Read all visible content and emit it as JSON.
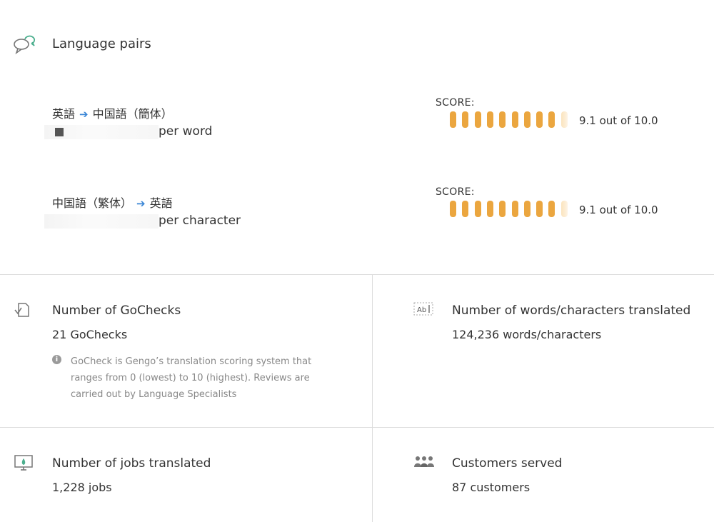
{
  "header": {
    "title": "Language pairs",
    "icon": "speech-bubbles-icon"
  },
  "pairs": [
    {
      "source": "英語",
      "target": "中国語（簡体）",
      "arrow": "➔",
      "price_unit": "per word",
      "score_label": "SCORE:",
      "score": 9.1,
      "score_text": "9.1 out of 10.0"
    },
    {
      "source": "中国語（繁体）",
      "target": "英語",
      "arrow": "➔",
      "price_unit": "per character",
      "score_label": "SCORE:",
      "score": 9.1,
      "score_text": "9.1 out of 10.0"
    }
  ],
  "stats": {
    "gochecks": {
      "title": "Number of GoChecks",
      "value": "21 GoChecks",
      "note": "GoCheck is Gengo’s translation scoring system that ranges from 0 (lowest) to 10 (highest). Reviews are carried out by Language Specialists",
      "icon": "document-check-icon"
    },
    "words": {
      "title": "Number of words/characters translated",
      "value": "124,236 words/characters",
      "icon": "text-ab-icon"
    },
    "jobs": {
      "title": "Number of jobs translated",
      "value": "1,228 jobs",
      "icon": "monitor-icon"
    },
    "customers": {
      "title": "Customers served",
      "value": "87 customers",
      "icon": "people-group-icon"
    }
  },
  "colors": {
    "score_bar": "#eba63f",
    "score_bar_partial": "#fbe5c1",
    "arrow": "#3a86d6",
    "icon_accent": "#4caf8e"
  }
}
